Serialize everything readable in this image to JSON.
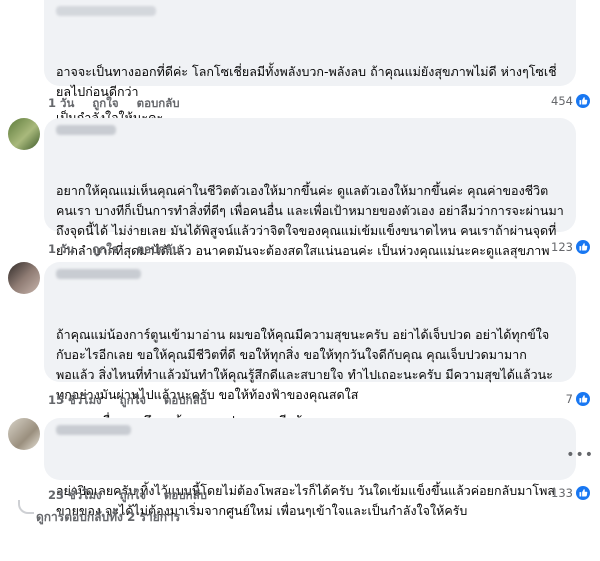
{
  "comments": [
    {
      "paragraphs": [
        "อาจจะเป็นทางออกที่ดีค่ะ โลกโซเชี่ยลมีทั้งพลังบวก-พลังลบ ถ้าคุณแม่ยังสุขภาพไม่ดี ห่างๆโซเชี่ยลไปก่อนดีกว่า",
        "เป็นกำลังใจให้นะคะ"
      ],
      "time": "1 วัน",
      "like": "ถูกใจ",
      "reply": "ตอบกลับ",
      "count": "454"
    },
    {
      "paragraphs": [
        "อยากให้คุณแม่เห็นคุณค่าในชีวิตตัวเองให้มากขึ้นค่ะ ดูแลตัวเองให้มากขึ้นค่ะ คุณค่าของชีวิตคนเรา บางทีก็เป็นการทำสิ่งที่ดีๆ เพื่อคนอื่น และเพื่อเป้าหมายของตัวเอง อย่าลืมว่าการจะผ่านมาถึงจุดนี้ได้ ไม่ง่ายเลย มันได้พิสูจน์แล้วว่าจิตใจของคุณแม่เข้มแข็งขนาดไหน คนเราถ้าผ่านจุดที่ยากลำบากที่สุดมาได้แล้ว อนาคตมันจะต้องสดใสแน่นอนค่ะ เป็นห่วงคุณแม่นะคะดูแลสุขภาพ ดูแลตัวเองด้วยค่ะ ❤️ ✌"
      ],
      "time": "1 วัน",
      "like": "ถูกใจ",
      "reply": "ตอบกลับ",
      "count": "123"
    },
    {
      "paragraphs": [
        "ถ้าคุณแม่น้องการ์ตูนเข้ามาอ่าน ผมขอให้คุณมีความสุขนะครับ อย่าได้เจ็บปวด อย่าได้ทุกข์ใจกับอะไรอีกเลย ขอให้คุณมีชีวิตที่ดี ขอให้ทุกสิ่ง ขอให้ทุกวันใจดีกับคุณ คุณเจ็บปวดมามากพอแล้ว สิ่งไหนที่ทำแล้วมันทำให้คุณรู้สึกดีและสบายใจ ทำไปเถอะนะครับ มีความสุขได้แล้วนะ ทุกอย่างมันผ่านไปแล้วนะครับ ขอให้ท้องฟ้าของคุณสดใส",
        ".....จากเพื่อนคนนึง....ด้วยความปรารถนาดีครับ"
      ],
      "time": "15 ชั่วโมง",
      "like": "ถูกใจ",
      "reply": "ตอบกลับ",
      "count": "7"
    },
    {
      "paragraphs": [
        "อย่าปิดเลยครับ ทิ้งไว้แบบนี้โดยไม่ต้องโพสอะไรก็ได้ครับ วันใดเข้มแข็งขึ้นแล้วค่อยกลับมาโพสขายของ จะได้ไม่ต้องมาเริ่มจากศูนย์ใหม่ เพื่อนๆเข้าใจและเป็นกำลังใจให้ครับ"
      ],
      "time": "23 ชั่วโมง",
      "like": "ถูกใจ",
      "reply": "ตอบกลับ",
      "count": "133"
    }
  ],
  "more_replies": "ดูการตอบกลับทั้ง 2 รายการ",
  "colors": {
    "bubble": "#f0f2f5",
    "like_blue": "#1877f2",
    "muted": "#65676b"
  },
  "icons": [
    "like-icon",
    "more-options-icon",
    "avatar"
  ]
}
